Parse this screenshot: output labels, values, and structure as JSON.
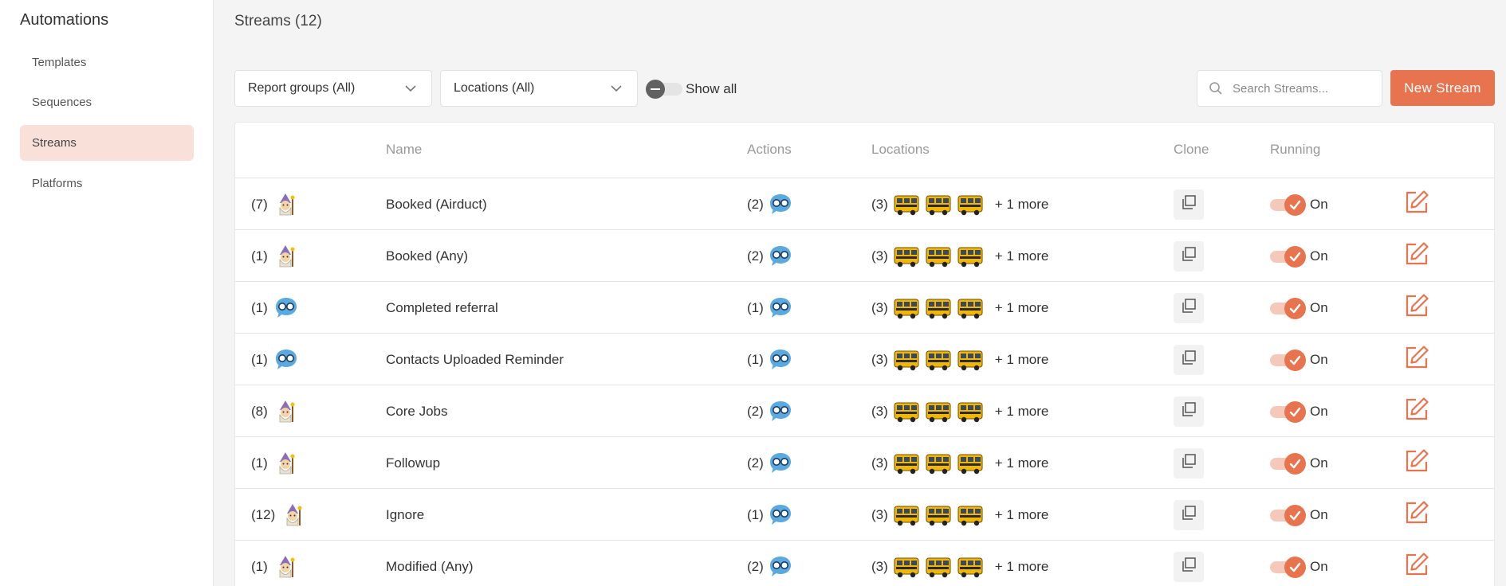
{
  "sidebar": {
    "title": "Automations",
    "items": [
      {
        "label": "Templates",
        "active": false
      },
      {
        "label": "Sequences",
        "active": false
      },
      {
        "label": "Streams",
        "active": true
      },
      {
        "label": "Platforms",
        "active": false
      }
    ]
  },
  "header": {
    "title": "Streams (12)"
  },
  "toolbar": {
    "report_groups": "Report groups (All)",
    "locations": "Locations (All)",
    "show_all_label": "Show all",
    "search_placeholder": "Search Streams...",
    "new_stream_label": "New Stream"
  },
  "table": {
    "columns": {
      "name": "Name",
      "actions": "Actions",
      "locations": "Locations",
      "clone": "Clone",
      "running": "Running"
    },
    "rows": [
      {
        "count": "(7)",
        "avatar": "wizard-avatar",
        "name": "Booked (Airduct)",
        "actions": "(2)",
        "locations": "(3)",
        "more": "+ 1 more",
        "running": "On"
      },
      {
        "count": "(1)",
        "avatar": "wizard-avatar",
        "name": "Booked (Any)",
        "actions": "(2)",
        "locations": "(3)",
        "more": "+ 1 more",
        "running": "On"
      },
      {
        "count": "(1)",
        "avatar": "chat-avatar",
        "name": "Completed referral",
        "actions": "(1)",
        "locations": "(3)",
        "more": "+ 1 more",
        "running": "On"
      },
      {
        "count": "(1)",
        "avatar": "chat-avatar",
        "name": "Contacts Uploaded Reminder",
        "actions": "(1)",
        "locations": "(3)",
        "more": "+ 1 more",
        "running": "On"
      },
      {
        "count": "(8)",
        "avatar": "wizard-avatar",
        "name": "Core Jobs",
        "actions": "(2)",
        "locations": "(3)",
        "more": "+ 1 more",
        "running": "On"
      },
      {
        "count": "(1)",
        "avatar": "wizard-avatar",
        "name": "Followup",
        "actions": "(2)",
        "locations": "(3)",
        "more": "+ 1 more",
        "running": "On"
      },
      {
        "count": "(12)",
        "avatar": "wizard-avatar",
        "name": "Ignore",
        "actions": "(1)",
        "locations": "(3)",
        "more": "+ 1 more",
        "running": "On"
      },
      {
        "count": "(1)",
        "avatar": "wizard-avatar",
        "name": "Modified (Any)",
        "actions": "(2)",
        "locations": "(3)",
        "more": "+ 1 more",
        "running": "On"
      }
    ]
  },
  "colors": {
    "accent": "#e8744f",
    "active_nav_bg": "#f9e1da",
    "chat_icon": "#5aa9e0",
    "bus_yellow": "#f2b705"
  }
}
